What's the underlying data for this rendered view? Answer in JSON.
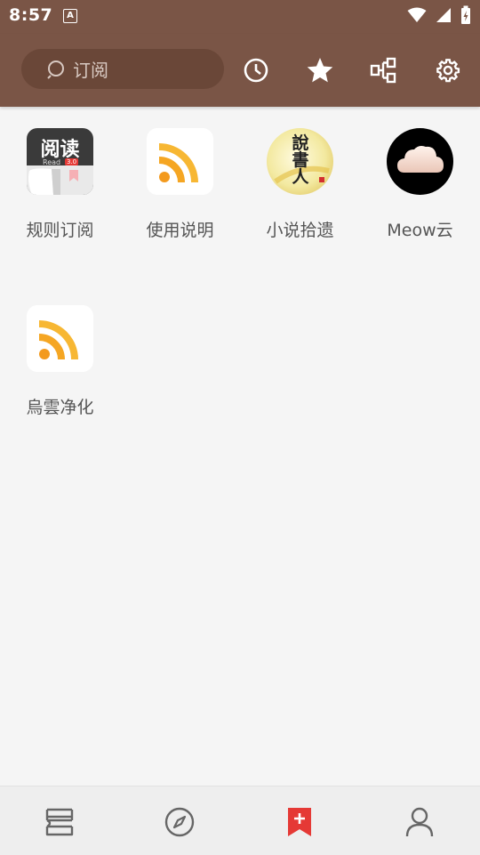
{
  "status": {
    "time": "8:57",
    "notif_badge": "A"
  },
  "search": {
    "placeholder": "订阅"
  },
  "toolbar_icons": [
    "history-icon",
    "star-icon",
    "group-icon",
    "settings-icon"
  ],
  "sources": [
    {
      "label": "规则订阅",
      "icon": "read-app-icon",
      "badge_text": "阅读",
      "sub_text": "Read",
      "version": "3.0"
    },
    {
      "label": "使用说明",
      "icon": "rss-icon"
    },
    {
      "label": "小说拾遗",
      "icon": "novel-seal-icon",
      "seal_text": "說書人"
    },
    {
      "label": "Meow云",
      "icon": "cloud-icon"
    },
    {
      "label": "烏雲净化",
      "icon": "rss-icon"
    }
  ],
  "nav": [
    "bookshelf-icon",
    "explore-icon",
    "rss-subscribe-icon",
    "profile-icon"
  ],
  "colors": {
    "primary": "#7a5546",
    "accent": "#e53935",
    "rss_orange": "#f5a623"
  }
}
